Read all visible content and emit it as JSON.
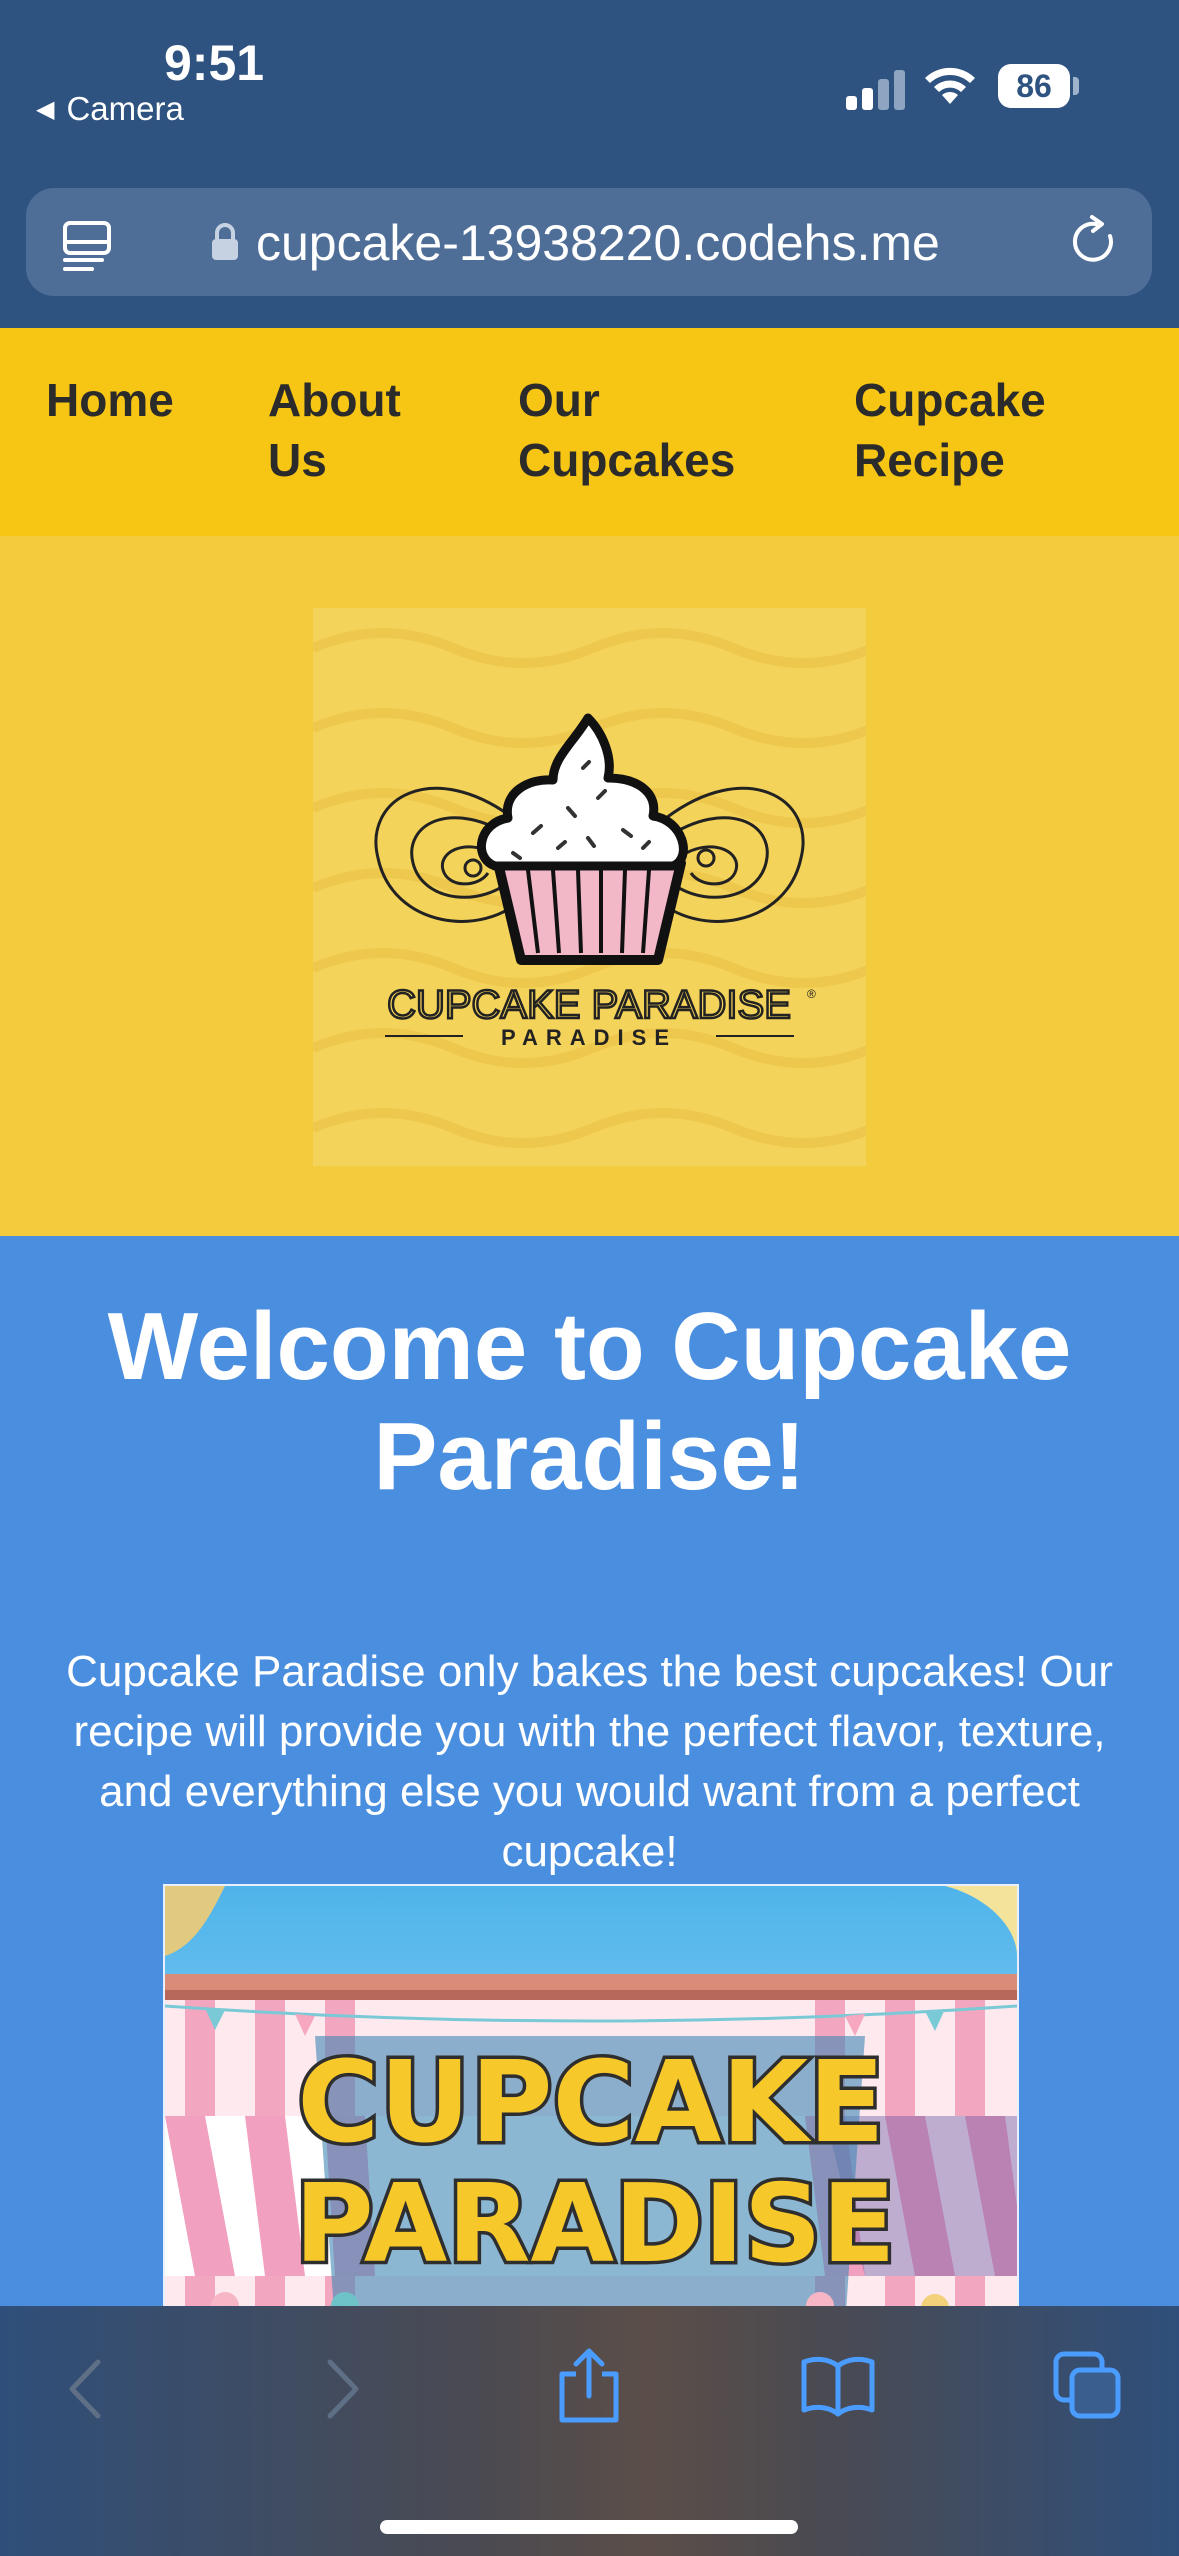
{
  "status": {
    "time": "9:51",
    "back_app": "Camera",
    "battery": "86"
  },
  "browser": {
    "url": "cupcake-13938220.codehs.me"
  },
  "nav": {
    "items": [
      {
        "line1": "Home",
        "line2": ""
      },
      {
        "line1": "About",
        "line2": "Us"
      },
      {
        "line1": "Our",
        "line2": "Cupcakes"
      },
      {
        "line1": "Cupcake",
        "line2": "Recipe"
      }
    ]
  },
  "logo": {
    "text_main": "CUPCAKE PARADISE",
    "text_sub": "PARADISE",
    "registered": "®"
  },
  "welcome": {
    "title": "Welcome to Cupcake Paradise!",
    "body": "Cupcake Paradise only bakes the best cupcakes! Our recipe will provide you with the perfect flavor, texture, and everything else you would want from a perfect cupcake!"
  },
  "banner": {
    "line1": "CUPCAKE",
    "line2": "PARADISE"
  },
  "colors": {
    "browser_chrome": "#2f5380",
    "nav_bg": "#f7c614",
    "logo_bg": "#f2cc3d",
    "welcome_bg": "#4a8ee0",
    "toolbar_icon_active": "#4a9cff"
  },
  "toolbar": {
    "icons": [
      "back-icon",
      "forward-icon",
      "share-icon",
      "bookmarks-icon",
      "tabs-icon"
    ]
  }
}
